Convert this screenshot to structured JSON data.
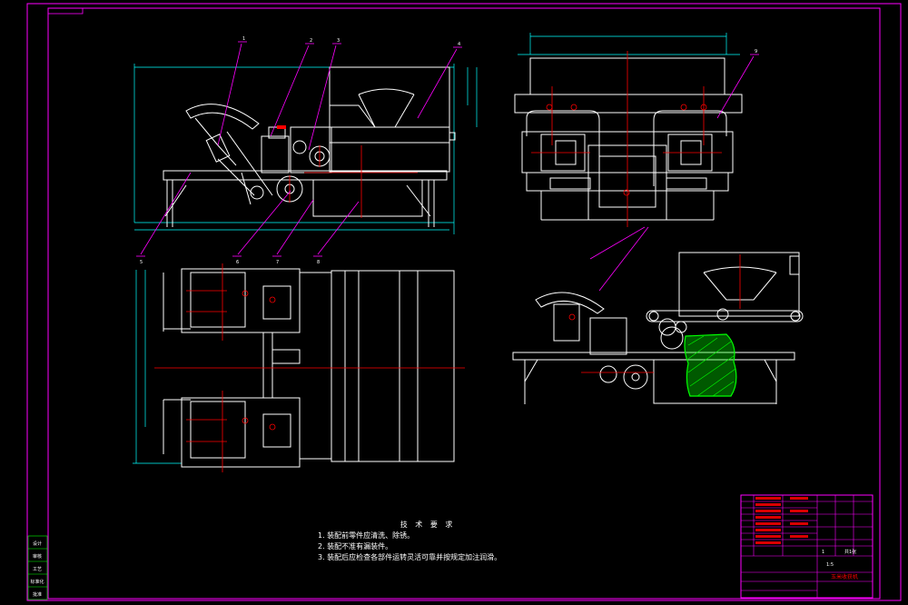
{
  "technical_notes": {
    "title": "技 术 要 求",
    "items": [
      "1. 装配前零件应清洗、除锈。",
      "2. 装配不准有漏装件。",
      "3. 装配后应检查各部件运转灵活可靠并按规定加注润滑。"
    ]
  },
  "balloons": [
    "1",
    "2",
    "3",
    "4",
    "5",
    "6",
    "7",
    "8",
    "9"
  ],
  "title_block": {
    "drawing_title": "玉米收获机",
    "scale": "1:5",
    "sheet": "共1张",
    "count": "1"
  },
  "side_stamp": [
    "设计",
    "审核",
    "工艺",
    "标准化",
    "批准"
  ],
  "colors": {
    "background": "#000000",
    "frame": "#ff00ff",
    "geometry": "#ffffff",
    "centerline": "#ff0000",
    "dimension": "#00ffff",
    "leader": "#ff00ff",
    "section_hatch": "#00ff00",
    "title_text": "#ff0000"
  }
}
